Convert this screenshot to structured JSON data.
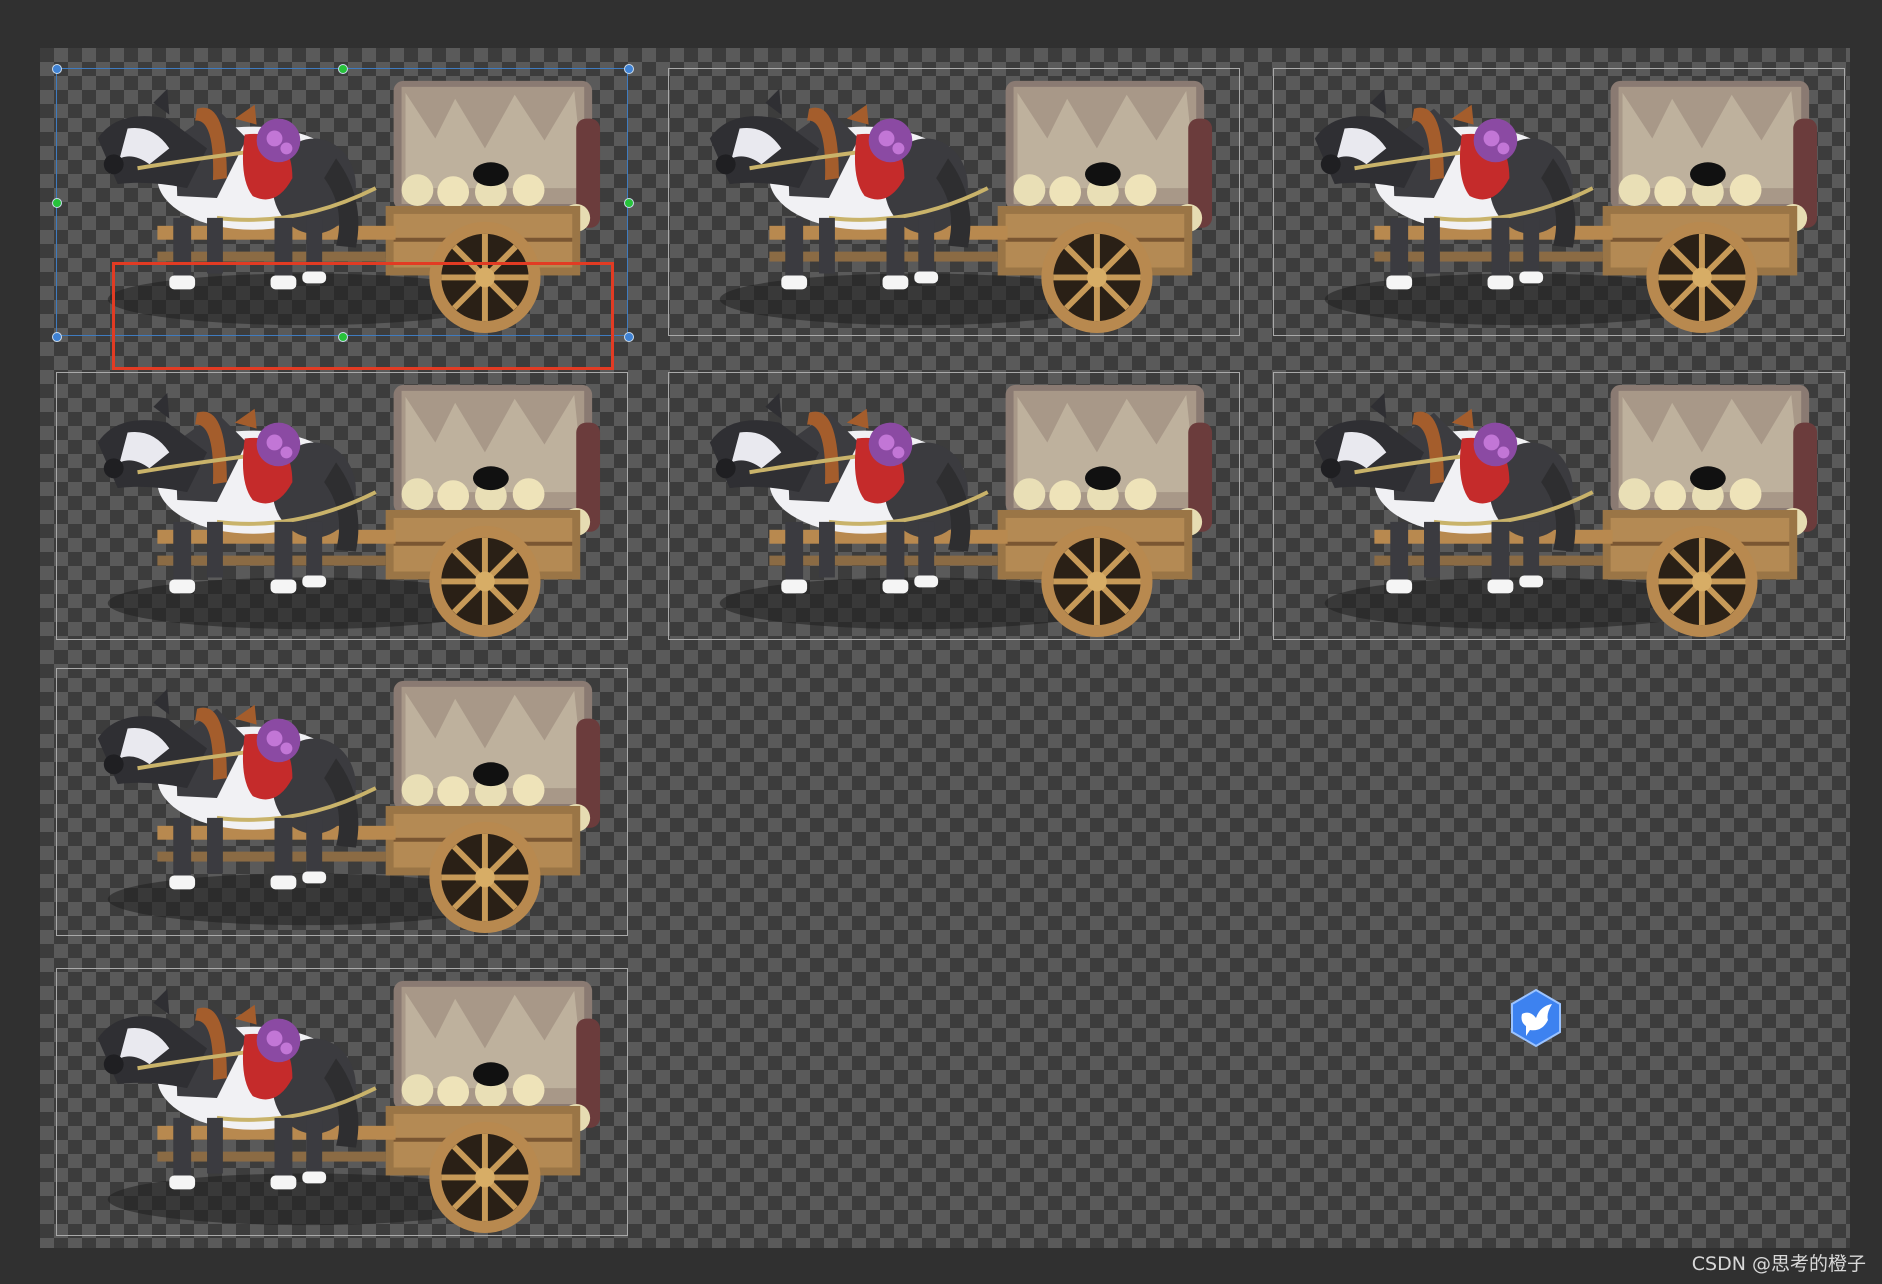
{
  "sprite_sheet": {
    "rows": [
      3,
      3,
      1,
      1
    ],
    "sprite_name": "horse-cart-sprite",
    "selected_index": 0
  },
  "colors": {
    "background": "#303030",
    "checker_dark": "#3c3c3c",
    "checker_light": "#5a5a5a",
    "cell_border": "#a9a9a9",
    "selection": "#3f7bbf",
    "selection_handle_mid": "#27c23a",
    "annotation": "#e23b23",
    "badge": "#3d82f0"
  },
  "watermark": "CSDN @思考的橙子"
}
